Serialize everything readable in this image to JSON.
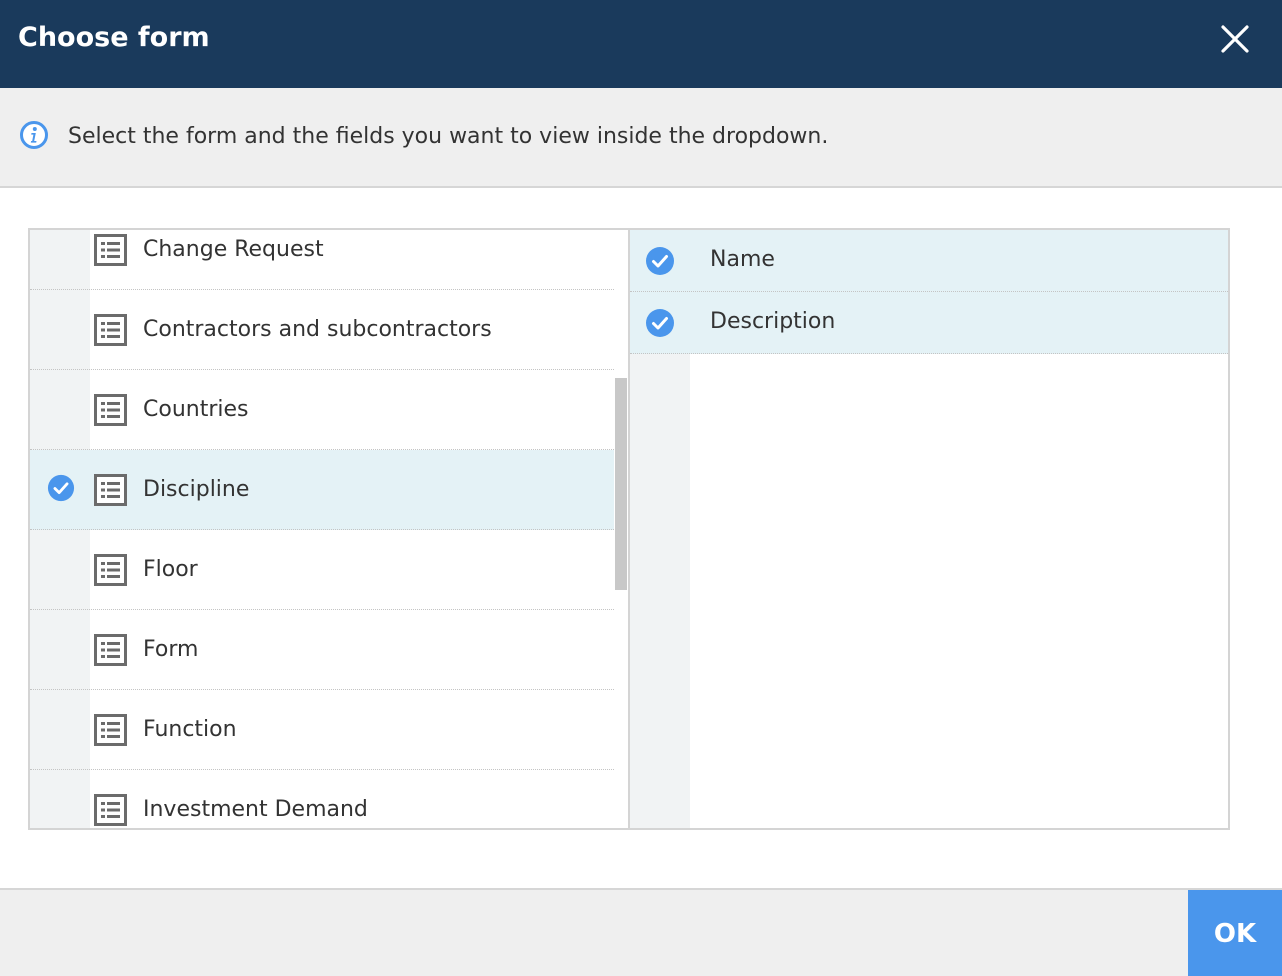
{
  "dialog": {
    "title": "Choose form",
    "close_icon": "close-icon"
  },
  "info": {
    "icon": "info-icon",
    "text": "Select the form and the fields you want to view inside the dropdown."
  },
  "forms": {
    "items": [
      {
        "label": "Change Request",
        "selected": false
      },
      {
        "label": "Contractors and subcontractors",
        "selected": false
      },
      {
        "label": "Countries",
        "selected": false
      },
      {
        "label": "Discipline",
        "selected": true
      },
      {
        "label": "Floor",
        "selected": false
      },
      {
        "label": "Form",
        "selected": false
      },
      {
        "label": "Function",
        "selected": false
      },
      {
        "label": "Investment Demand",
        "selected": false
      }
    ]
  },
  "fields": {
    "items": [
      {
        "label": "Name",
        "selected": true
      },
      {
        "label": "Description",
        "selected": true
      }
    ]
  },
  "footer": {
    "ok_label": "OK"
  },
  "colors": {
    "header_bg": "#1a3a5c",
    "accent": "#4a96ec",
    "selected_row": "#e4f2f6"
  }
}
